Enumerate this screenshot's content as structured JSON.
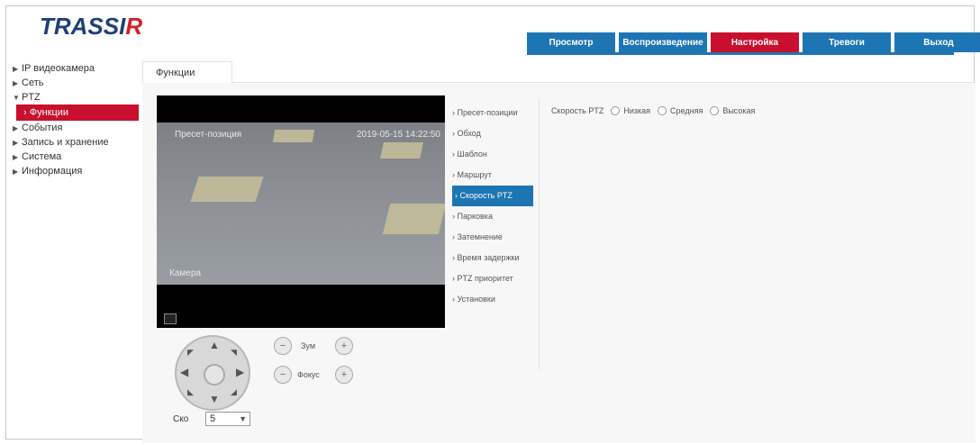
{
  "logo": {
    "main": "TRASSI",
    "accent": "R"
  },
  "topnav": [
    {
      "label": "Просмотр"
    },
    {
      "label": "Воспроизведение"
    },
    {
      "label": "Настройка",
      "active": true
    },
    {
      "label": "Тревоги"
    },
    {
      "label": "Выход"
    }
  ],
  "sidebar": {
    "items": [
      {
        "label": "IP видеокамера"
      },
      {
        "label": "Сеть"
      },
      {
        "label": "PTZ"
      },
      {
        "label": "Функции"
      },
      {
        "label": "События"
      },
      {
        "label": "Запись и хранение"
      },
      {
        "label": "Система"
      },
      {
        "label": "Информация"
      }
    ]
  },
  "content_tab": "Функции",
  "video": {
    "overlay_left": "Пресет-позиция",
    "overlay_right": "2019-05-15 14:22:50",
    "overlay_bottom": "Камера"
  },
  "ptz_controls": {
    "zoom_label": "Зум",
    "focus_label": "Фокус",
    "speed_label": "Ско",
    "speed_value": "5"
  },
  "function_menu": [
    {
      "label": "Пресет-позиции"
    },
    {
      "label": "Обход"
    },
    {
      "label": "Шаблон"
    },
    {
      "label": "Маршрут"
    },
    {
      "label": "Скорость PTZ",
      "active": true
    },
    {
      "label": "Парковка"
    },
    {
      "label": "Затемнение"
    },
    {
      "label": "Время задержки"
    },
    {
      "label": "PTZ приоритет"
    },
    {
      "label": "Установки"
    }
  ],
  "speed_options": {
    "title": "Скорость PTZ",
    "option1": "Низкая",
    "option2": "Средняя",
    "option3": "Высокая"
  },
  "colors": {
    "brand_blue": "#1d75b4",
    "brand_red": "#c8102e",
    "logo_blue": "#1e3f77"
  }
}
